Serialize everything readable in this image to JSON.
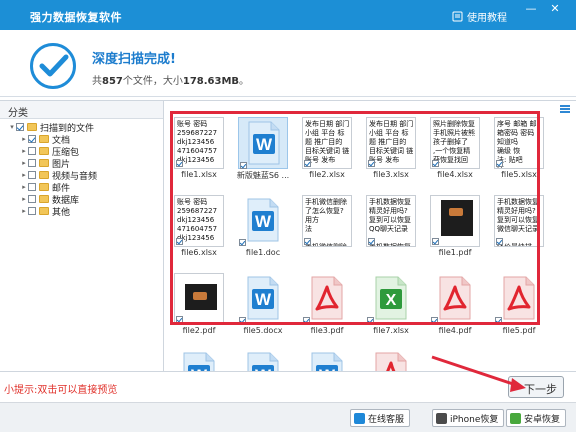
{
  "window": {
    "title": "强力数据恢复软件",
    "help_label": "使用教程",
    "min_glyph": "—",
    "close_glyph": "✕"
  },
  "header": {
    "title": "深度扫描完成!",
    "summary_prefix": "共",
    "file_count": "857",
    "summary_mid": "个文件，大小",
    "total_size": "178.63MB",
    "summary_suffix": "。"
  },
  "sidebar": {
    "header": "分类",
    "tree": [
      {
        "label": "扫描到的文件",
        "level": 0,
        "checked": true,
        "expanded": true
      },
      {
        "label": "文档",
        "level": 1,
        "checked": true,
        "expanded": false
      },
      {
        "label": "压缩包",
        "level": 1,
        "checked": false,
        "expanded": false
      },
      {
        "label": "图片",
        "level": 1,
        "checked": false,
        "expanded": false
      },
      {
        "label": "视频与音频",
        "level": 1,
        "checked": false,
        "expanded": false
      },
      {
        "label": "邮件",
        "level": 1,
        "checked": false,
        "expanded": false
      },
      {
        "label": "数据库",
        "level": 1,
        "checked": false,
        "expanded": false
      },
      {
        "label": "其他",
        "level": 1,
        "checked": false,
        "expanded": false
      }
    ]
  },
  "files": [
    {
      "name": "file1.xlsx",
      "kind": "text",
      "text": "账号 密码\n259687227\ndkj123456\n471604757\ndkj123456"
    },
    {
      "name": "新版魅蓝S6 ...",
      "kind": "word-selected"
    },
    {
      "name": "file2.xlsx",
      "kind": "text",
      "text": "发布日期 部门\n小组 平台 标\n题 推广目的\n目标关键词 链\n账号 发布"
    },
    {
      "name": "file3.xlsx",
      "kind": "text",
      "text": "发布日期 部门\n小组 平台 标\n题 推广目的\n目标关键词 链\n账号 发布"
    },
    {
      "name": "file4.xlsx",
      "kind": "text",
      "text": "照片删除恢复\n手机照片被熊\n孩子删掉了\n,一个恢复精\n获恢复找回"
    },
    {
      "name": "file5.xlsx",
      "kind": "text",
      "text": "序号 邮箱 邮\n箱密码 密码\n知道吗\n确级 恢\n法: 贴吧\n注"
    },
    {
      "name": "file6.xlsx",
      "kind": "text",
      "text": "账号 密码\n259687227\ndkj123456\n471604757\ndkj123456"
    },
    {
      "name": "file1.doc",
      "kind": "word"
    },
    {
      "name": "",
      "kind": "text",
      "text": "手机微信删除\n了怎么恢复?\n用方\n法\n\n手机微信删除"
    },
    {
      "name": "",
      "kind": "text",
      "text": "手机数据恢复\n精灵好用吗?\n复到可以恢复\nQQ聊天记录\n\n手机数据恢复"
    },
    {
      "name": "file1.pdf",
      "kind": "dark"
    },
    {
      "name": "",
      "kind": "text",
      "text": "手机数据恢复\n精灵好用吗?\n复到可以恢复\n微信聊天记录\n\n降价最快排..."
    },
    {
      "name": "file2.pdf",
      "kind": "dark-small"
    },
    {
      "name": "file5.docx",
      "kind": "word"
    },
    {
      "name": "file3.pdf",
      "kind": "pdf"
    },
    {
      "name": "file7.xlsx",
      "kind": "excel"
    },
    {
      "name": "file4.pdf",
      "kind": "pdf"
    },
    {
      "name": "file5.pdf",
      "kind": "pdf"
    },
    {
      "name": "",
      "kind": "word"
    },
    {
      "name": "",
      "kind": "word"
    },
    {
      "name": "",
      "kind": "word"
    },
    {
      "name": "",
      "kind": "pdf"
    }
  ],
  "tip": "小提示:双击可以直接预览",
  "next_label": "下一步",
  "footer": {
    "buttons": [
      {
        "label": "在线客服",
        "color": "#1e88d8"
      },
      {
        "label": "iPhone恢复",
        "color": "#4b4b4b"
      },
      {
        "label": "安卓恢复",
        "color": "#48a83c"
      }
    ]
  },
  "colors": {
    "accent": "#1c8fd6",
    "highlight": "#e0283b",
    "tip": "#e0302a"
  }
}
